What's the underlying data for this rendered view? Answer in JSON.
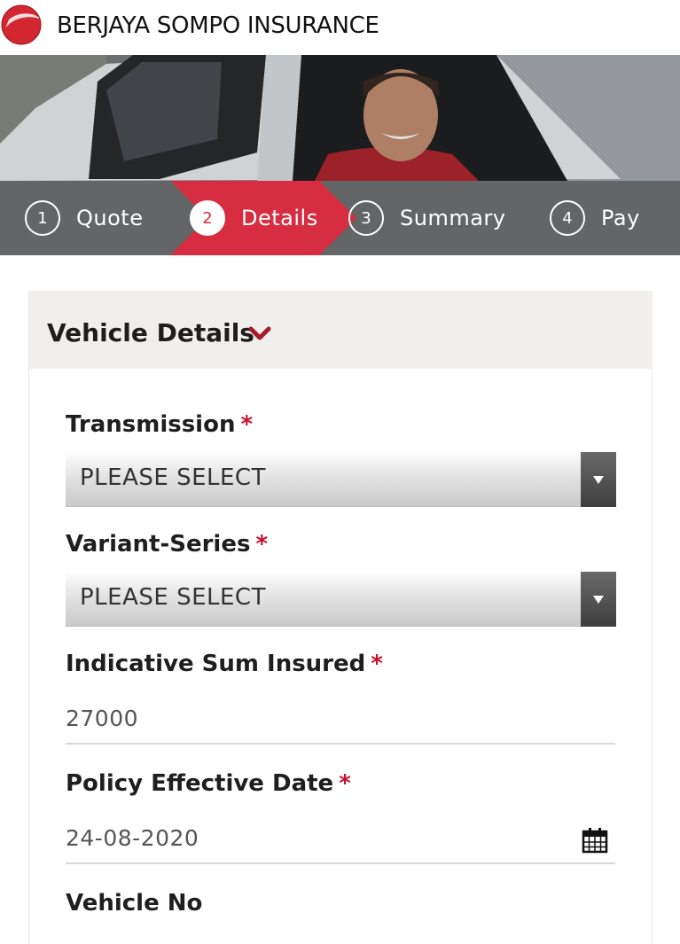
{
  "header": {
    "brand": "BERJAYA SOMPO INSURANCE",
    "logo_icon": "berjaya-sompo-logo"
  },
  "steps": [
    {
      "number": "1",
      "label": "Quote",
      "active": false
    },
    {
      "number": "2",
      "label": "Details",
      "active": true
    },
    {
      "number": "3",
      "label": "Summary",
      "active": false
    },
    {
      "number": "4",
      "label": "Pay",
      "active": false
    }
  ],
  "section": {
    "title": "Vehicle Details",
    "toggle_icon": "chevron-down-icon"
  },
  "fields": {
    "transmission": {
      "label": "Transmission",
      "required": "*",
      "value": "PLEASE SELECT"
    },
    "variant_series": {
      "label": "Variant-Series",
      "required": "*",
      "value": "PLEASE SELECT"
    },
    "sum_insured": {
      "label": "Indicative Sum Insured",
      "required": "*",
      "value": "27000"
    },
    "effective_date": {
      "label": "Policy Effective Date",
      "required": "*",
      "value": "24-08-2020",
      "icon": "calendar-icon"
    },
    "vehicle_no": {
      "label": "Vehicle No"
    }
  },
  "colors": {
    "accent": "#d62d40",
    "step_bar": "#646567",
    "section_header": "#f0efee",
    "required": "#c8102e"
  }
}
